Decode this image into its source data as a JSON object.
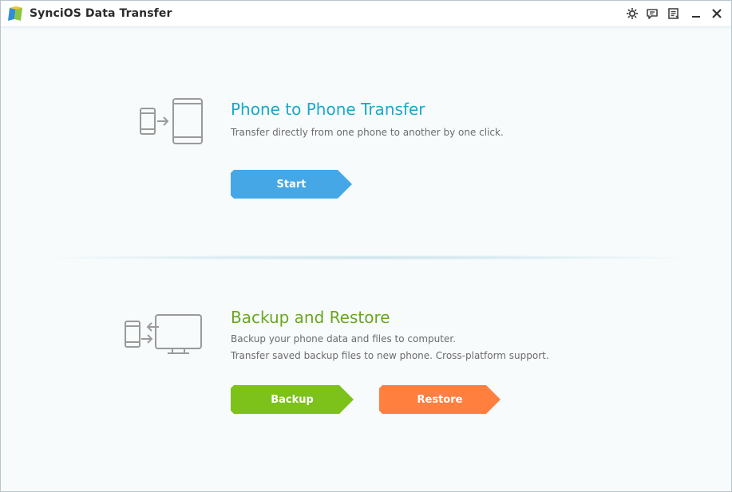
{
  "window": {
    "title": "SynciOS Data Transfer"
  },
  "titlebar_buttons": [
    {
      "icon": "gear-icon"
    },
    {
      "icon": "feedback-icon"
    },
    {
      "icon": "menu-list-icon"
    },
    {
      "icon": "minimize-icon"
    },
    {
      "icon": "close-icon"
    }
  ],
  "phone_transfer": {
    "title": "Phone to Phone Transfer",
    "description": "Transfer directly from one phone to another by one click.",
    "start_label": "Start",
    "title_color": "#1aa9c9",
    "button_color": "#45a7e6"
  },
  "backup_restore": {
    "title": "Backup and Restore",
    "description_line1": "Backup your phone data and files to computer.",
    "description_line2": "Transfer saved backup files to new phone. Cross-platform support.",
    "backup_label": "Backup",
    "restore_label": "Restore",
    "title_color": "#6aa61f",
    "backup_color": "#7cc21b",
    "restore_color": "#ff7f3f"
  }
}
